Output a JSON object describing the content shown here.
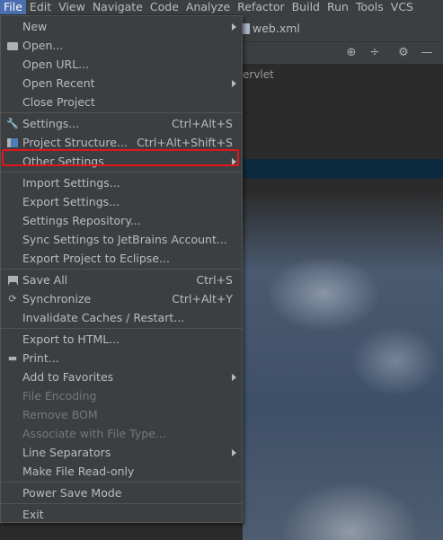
{
  "menubar": {
    "items": [
      "File",
      "Edit",
      "View",
      "Navigate",
      "Code",
      "Analyze",
      "Refactor",
      "Build",
      "Run",
      "Tools",
      "VCS"
    ]
  },
  "editor": {
    "tab_label": "web.xml"
  },
  "project_panel": {
    "servlet_text": "ervlet"
  },
  "file_menu": {
    "new": "New",
    "open": "Open...",
    "open_url": "Open URL...",
    "open_recent": "Open Recent",
    "close_project": "Close Project",
    "settings": "Settings...",
    "settings_sc": "Ctrl+Alt+S",
    "project_structure": "Project Structure...",
    "project_structure_sc": "Ctrl+Alt+Shift+S",
    "other_settings": "Other Settings",
    "import_settings": "Import Settings...",
    "export_settings": "Export Settings...",
    "settings_repository": "Settings Repository...",
    "sync_settings": "Sync Settings to JetBrains Account...",
    "export_eclipse": "Export Project to Eclipse...",
    "save_all": "Save All",
    "save_all_sc": "Ctrl+S",
    "synchronize": "Synchronize",
    "synchronize_sc": "Ctrl+Alt+Y",
    "invalidate_caches": "Invalidate Caches / Restart...",
    "export_html": "Export to HTML...",
    "print": "Print...",
    "add_favorites": "Add to Favorites",
    "file_encoding": "File Encoding",
    "remove_bom": "Remove BOM",
    "associate_file_type": "Associate with File Type...",
    "line_separators": "Line Separators",
    "make_readonly": "Make File Read-only",
    "power_save": "Power Save Mode",
    "exit": "Exit"
  },
  "colors": {
    "menubar_active": "#4b6eaf",
    "highlight_box": "#e0161a",
    "menu_bg": "#3c3f41",
    "disabled_text": "#777777"
  }
}
